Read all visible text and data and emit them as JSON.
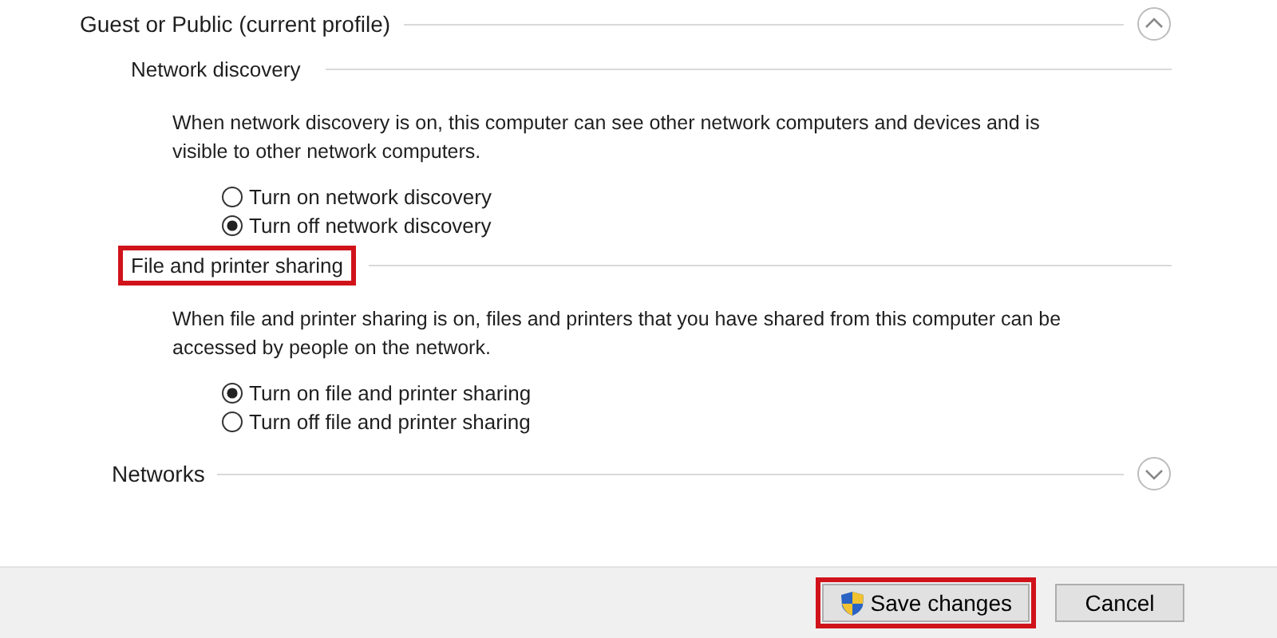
{
  "profile": {
    "title": "Guest or Public (current profile)",
    "expanded": true,
    "sections": [
      {
        "heading": "Network discovery",
        "highlighted": false,
        "description": "When network discovery is on, this computer can see other network computers and devices and is visible to other network computers.",
        "options": [
          {
            "label": "Turn on network discovery",
            "selected": false
          },
          {
            "label": "Turn off network discovery",
            "selected": true
          }
        ]
      },
      {
        "heading": "File and printer sharing",
        "highlighted": true,
        "description": "When file and printer sharing is on, files and printers that you have shared from this computer can be accessed by people on the network.",
        "options": [
          {
            "label": "Turn on file and printer sharing",
            "selected": true
          },
          {
            "label": "Turn off file and printer sharing",
            "selected": false
          }
        ]
      }
    ]
  },
  "networks": {
    "title": "Networks",
    "expanded": false
  },
  "buttons": [
    {
      "label": "Save changes",
      "kind": "shield",
      "highlighted": true
    },
    {
      "label": "Cancel",
      "kind": "plain",
      "highlighted": false
    }
  ]
}
